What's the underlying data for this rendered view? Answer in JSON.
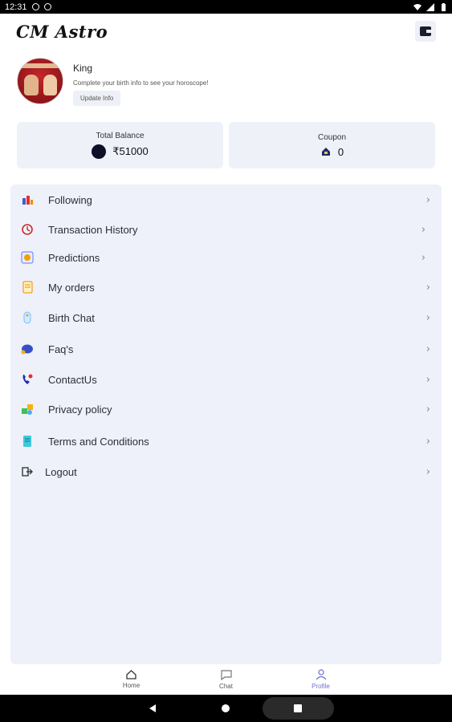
{
  "status_bar": {
    "time": "12:31"
  },
  "app": {
    "title": "CM Astro"
  },
  "profile": {
    "name": "King",
    "hint": "Complete your birth info to see your horoscope!",
    "update_label": "Update Info"
  },
  "balance": {
    "label": "Total Balance",
    "value": "₹51000"
  },
  "coupon": {
    "label": "Coupon",
    "value": "0"
  },
  "menu": [
    {
      "label": "Following",
      "icon": "following-icon"
    },
    {
      "label": "Transaction History",
      "icon": "transaction-history-icon"
    },
    {
      "label": "Predictions",
      "icon": "predictions-icon"
    },
    {
      "label": "My orders",
      "icon": "orders-icon"
    },
    {
      "label": "Birth Chat",
      "icon": "birth-chat-icon"
    },
    {
      "label": "Faq's",
      "icon": "faq-icon"
    },
    {
      "label": "ContactUs",
      "icon": "contact-icon"
    },
    {
      "label": "Privacy policy",
      "icon": "privacy-icon"
    },
    {
      "label": "Terms and Conditions",
      "icon": "terms-icon"
    },
    {
      "label": "Logout",
      "icon": "logout-icon"
    }
  ],
  "bottom_nav": [
    {
      "label": "Home",
      "icon": "home-icon"
    },
    {
      "label": "Chat",
      "icon": "chat-icon"
    },
    {
      "label": "Profile",
      "icon": "profile-icon",
      "active": true
    }
  ],
  "colors": {
    "accent": "#6a6fd0",
    "panel": "#eef1f9",
    "coin": "#0e1028"
  }
}
